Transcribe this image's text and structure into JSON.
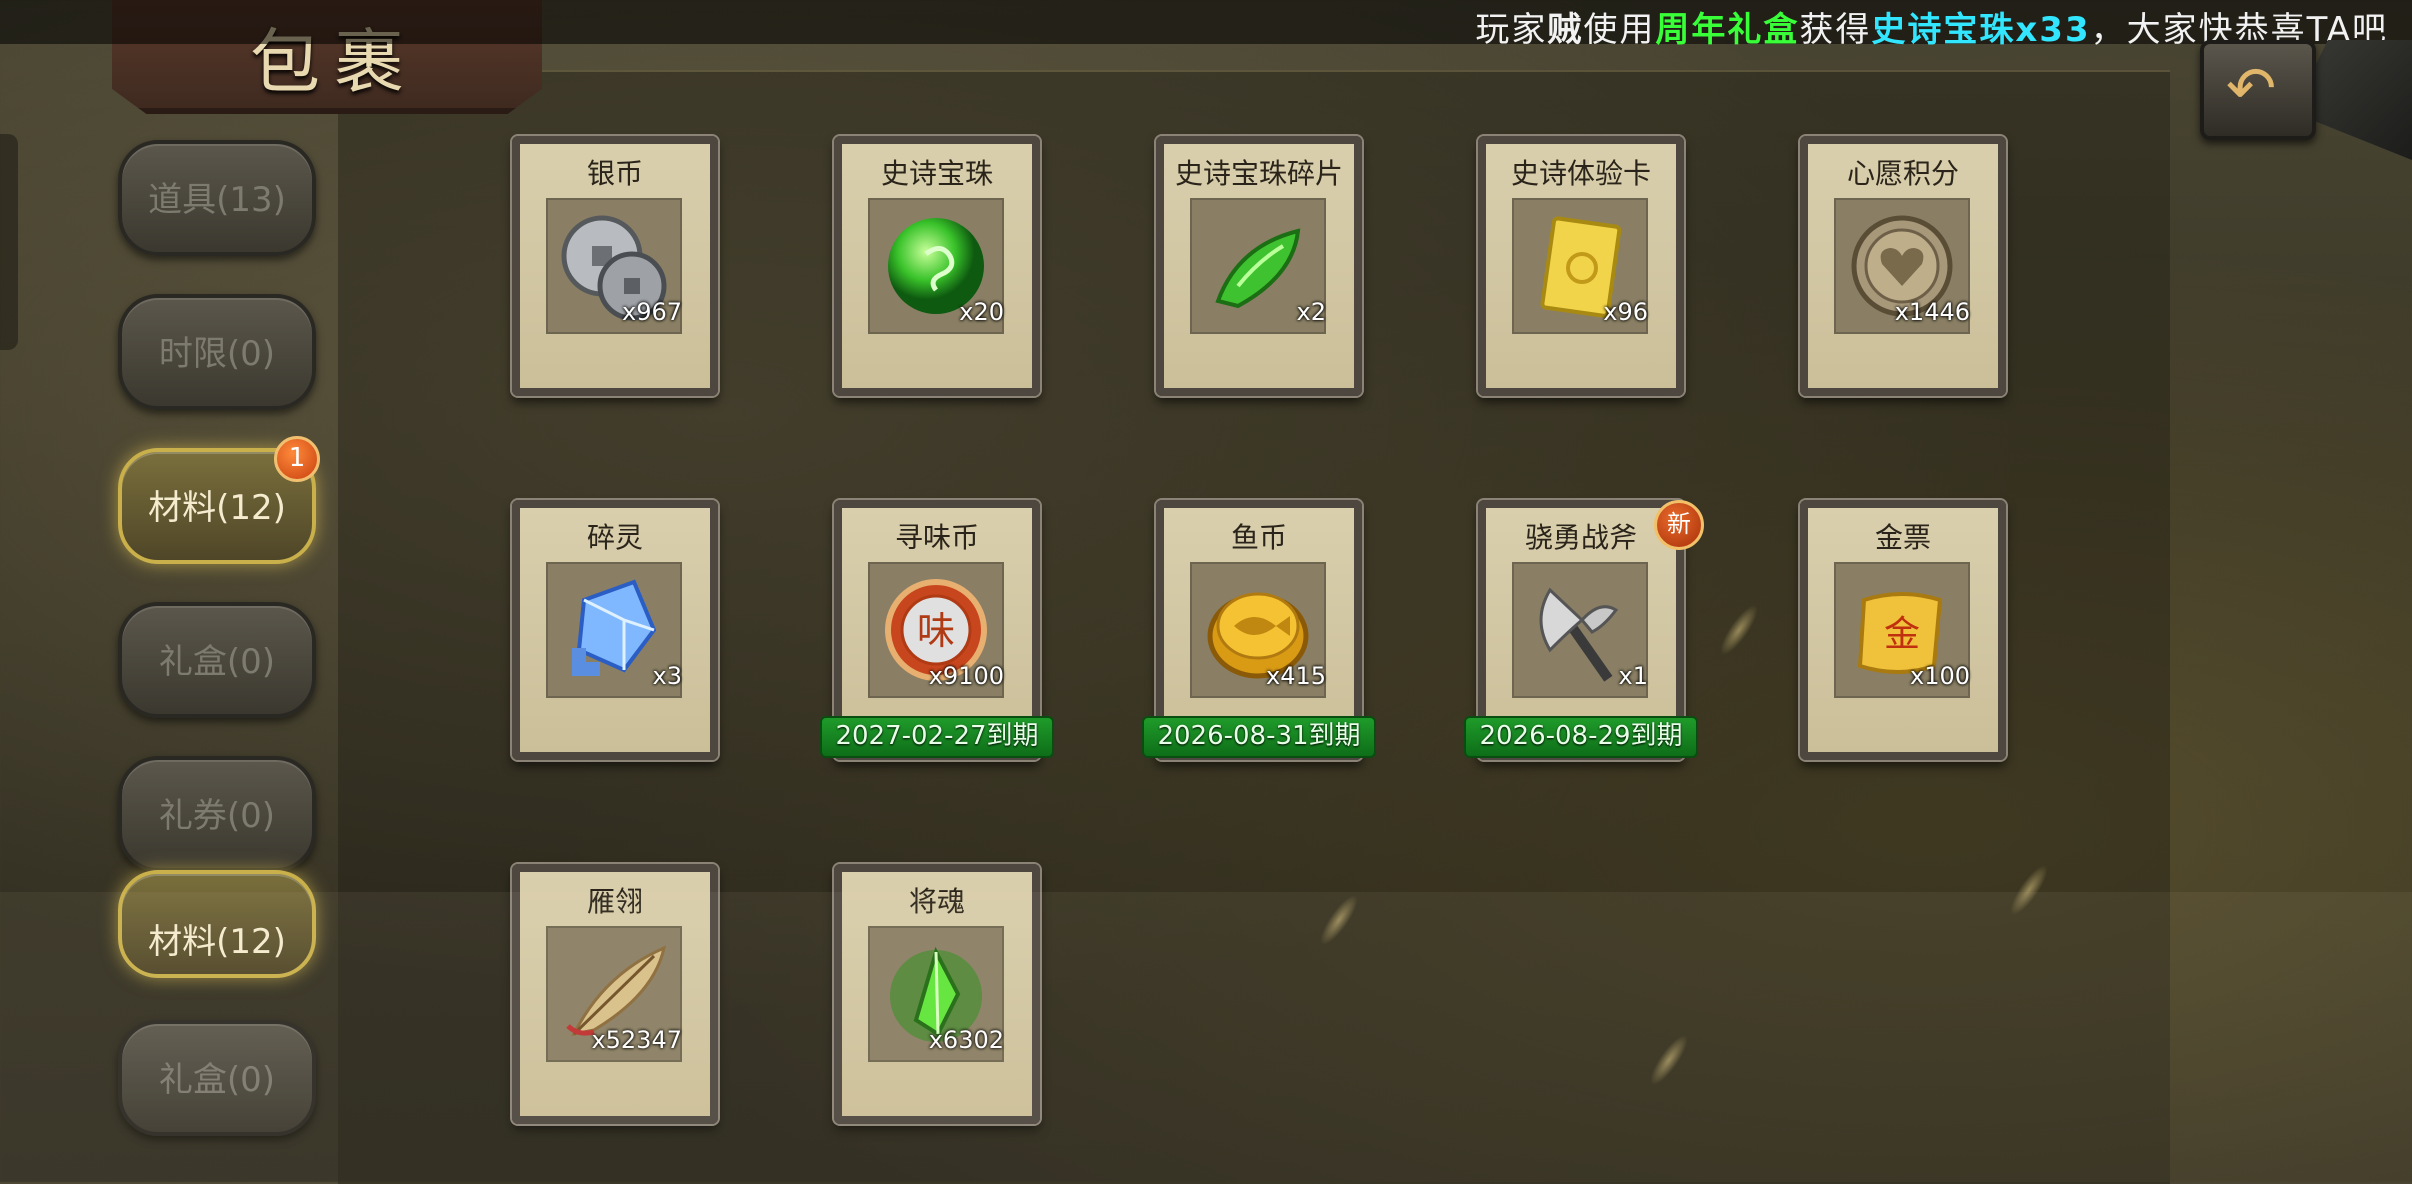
{
  "header": {
    "title": "包裹"
  },
  "marquee": {
    "prefix": "玩家",
    "name": "贼",
    "verb": "使用",
    "source_item": "周年礼盒",
    "gain": "获得",
    "reward": "史诗宝珠x33",
    "suffix": "，大家快恭喜TA吧"
  },
  "sidebar": {
    "tabs": [
      {
        "label": "道具(13)",
        "active": false
      },
      {
        "label": "时限(0)",
        "active": false
      },
      {
        "label": "材料(12)",
        "active": true,
        "badge": "1"
      },
      {
        "label": "礼盒(0)",
        "active": false
      },
      {
        "label": "礼券(0)",
        "active": false
      },
      {
        "label": "材料(12)",
        "active": true
      },
      {
        "label": "礼盒(0)",
        "active": false
      }
    ]
  },
  "items": [
    {
      "name": "银币",
      "qty": "x967",
      "icon": "silver-coin-icon"
    },
    {
      "name": "史诗宝珠",
      "qty": "x20",
      "icon": "epic-orb-icon"
    },
    {
      "name": "史诗宝珠碎片",
      "qty": "x2",
      "icon": "orb-shard-icon"
    },
    {
      "name": "史诗体验卡",
      "qty": "x96",
      "icon": "experience-card-icon"
    },
    {
      "name": "心愿积分",
      "qty": "x1446",
      "icon": "wish-point-icon"
    },
    {
      "name": "碎灵",
      "qty": "x3",
      "icon": "spirit-crystal-icon"
    },
    {
      "name": "寻味币",
      "qty": "x9100",
      "icon": "flavor-coin-icon",
      "expiry": "2027-02-27到期"
    },
    {
      "name": "鱼币",
      "qty": "x415",
      "icon": "fish-coin-icon",
      "expiry": "2026-08-31到期"
    },
    {
      "name": "骁勇战斧",
      "qty": "x1",
      "icon": "battle-axe-icon",
      "expiry": "2026-08-29到期",
      "badge": "新"
    },
    {
      "name": "金票",
      "qty": "x100",
      "icon": "gold-ticket-icon"
    },
    {
      "name": "雁翎",
      "qty": "x52347",
      "icon": "feather-icon"
    },
    {
      "name": "将魂",
      "qty": "x6302",
      "icon": "general-soul-icon"
    }
  ]
}
